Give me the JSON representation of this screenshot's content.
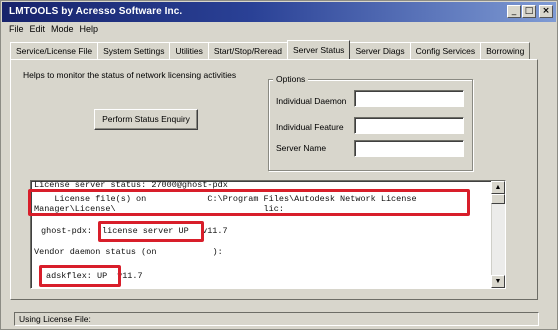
{
  "window": {
    "title": "LMTOOLS by Acresso Software Inc.",
    "minimize_glyph": "_",
    "maximize_glyph": "□",
    "close_glyph": "×"
  },
  "menu": [
    "File",
    "Edit",
    "Mode",
    "Help"
  ],
  "tabs": [
    {
      "label": "Service/License File",
      "active": false
    },
    {
      "label": "System Settings",
      "active": false
    },
    {
      "label": "Utilities",
      "active": false
    },
    {
      "label": "Start/Stop/Reread",
      "active": false
    },
    {
      "label": "Server Status",
      "active": true
    },
    {
      "label": "Server Diags",
      "active": false
    },
    {
      "label": "Config Services",
      "active": false
    },
    {
      "label": "Borrowing",
      "active": false
    }
  ],
  "server_status": {
    "help_text": "Helps to monitor the status of network licensing activities",
    "enquiry_button": "Perform Status Enquiry",
    "options": {
      "legend": "Options",
      "individual_daemon": "Individual Daemon",
      "individual_feature": "Individual Feature",
      "server_name": "Server Name"
    },
    "output": {
      "line1": "License server status: 27000@ghost-pdx",
      "line2": "    License file(s) on            C:\\Program Files\\Autodesk Network License",
      "line3": "Manager\\License\\                             lic:",
      "line4_prefix": "ghost-pdx: ",
      "line4_highlight": "license server UP",
      "line4_suffix": " v11.7",
      "line5": "Vendor daemon status (on           ):",
      "line6_highlight": "adskflex: UP",
      "line6_suffix": " v11.7"
    }
  },
  "statusbar": {
    "text": "Using License File:"
  },
  "colors": {
    "window_bg": "#d8d6cc",
    "title_bar_start": "#17236b",
    "title_bar_end": "#7f9bd4",
    "highlight_red": "#d81e2a"
  }
}
